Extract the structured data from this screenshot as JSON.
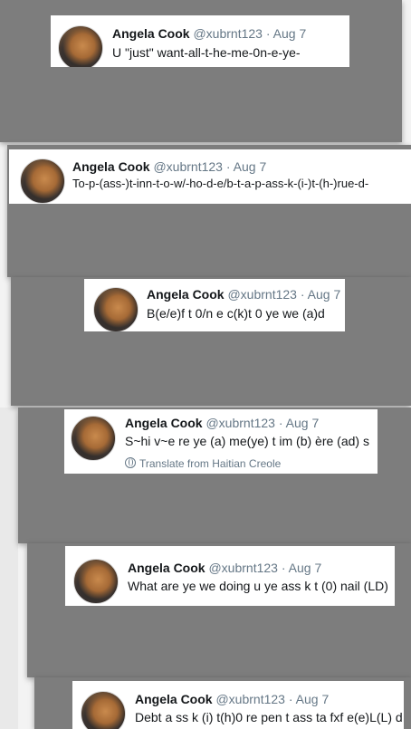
{
  "tweets": [
    {
      "author": "Angela Cook",
      "handle": "@xubrnt123",
      "separator": "·",
      "date": "Aug 7",
      "text": "U \"just\" want-all-t-he-me-0n-e-ye-"
    },
    {
      "author": "Angela Cook",
      "handle": "@xubrnt123",
      "separator": "·",
      "date": "Aug 7",
      "text": "To-p-(ass-)t-inn-t-o-w/-ho-d-e/b-t-a-p-ass-k-(i-)t-(h-)rue-d-"
    },
    {
      "author": "Angela Cook",
      "handle": "@xubrnt123",
      "separator": "·",
      "date": "Aug 7",
      "text": "B(e/e)f t 0/n e c(k)t 0 ye we (a)d"
    },
    {
      "author": "Angela Cook",
      "handle": "@xubrnt123",
      "separator": "·",
      "date": "Aug 7",
      "text": "S~hi v~e re ye (a) me(ye) t im (b) ère (ad) s",
      "translate": "Translate from Haitian Creole"
    },
    {
      "author": "Angela Cook",
      "handle": "@xubrnt123",
      "separator": "·",
      "date": "Aug 7",
      "text": "What are ye we doing u ye ass k t (0) nail (LD)"
    },
    {
      "author": "Angela Cook",
      "handle": "@xubrnt123",
      "separator": "·",
      "date": "Aug 7",
      "text": "Debt a ss k (i) t(h)0 re pen t ass ta fxf e(e)L(L) d"
    }
  ]
}
